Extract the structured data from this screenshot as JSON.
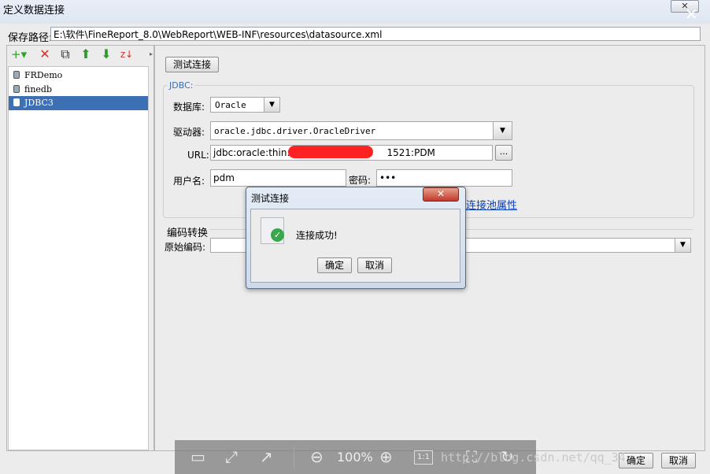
{
  "window": {
    "title": "定义数据连接",
    "close_glyph": "✕"
  },
  "save_path": {
    "label": "保存路径:",
    "value": "E:\\软件\\FineReport_8.0\\WebReport\\WEB-INF\\resources\\datasource.xml"
  },
  "toolbar": {
    "add": "+▾",
    "delete": "✕",
    "copy": "⧉",
    "up": "⬆",
    "down": "⬇",
    "sort": "z↓"
  },
  "connections": [
    "FRDemo",
    "finedb",
    "JDBC3"
  ],
  "selected_connection": "JDBC3",
  "test_button": "测试连接",
  "jdbc": {
    "legend": "JDBC:",
    "database_label": "数据库:",
    "database_value": "Oracle",
    "driver_label": "驱动器:",
    "driver_value": "oracle.jdbc.driver.OracleDriver",
    "url_label": "URL:",
    "url_prefix": "jdbc:oracle:thin:@",
    "url_suffix": "1521:PDM",
    "browse_label": "...",
    "user_label": "用户名:",
    "user_value": "pdm",
    "password_label": "密码:",
    "password_value": "•••",
    "pool_link": "连接池属性"
  },
  "encoding": {
    "title": "编码转换",
    "source_label": "原始编码:"
  },
  "dialog": {
    "title": "测试连接",
    "message": "连接成功!",
    "ok": "确定",
    "cancel": "取消"
  },
  "footer": {
    "ok": "确定",
    "cancel": "取消"
  },
  "viewer_overlay": {
    "zoom": "100%",
    "one_to_one": "1:1"
  },
  "watermark": "http://blog.csdn.net/qq_34"
}
